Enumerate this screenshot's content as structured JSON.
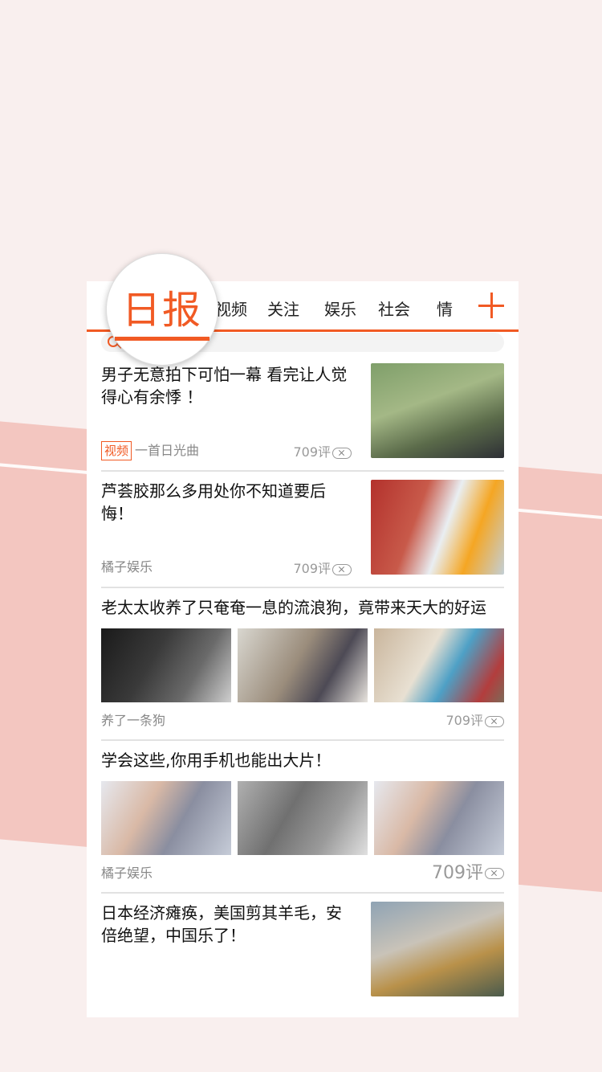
{
  "tabs": {
    "active_zoomed": "日报",
    "items": [
      "视频",
      "关注",
      "娱乐",
      "社会",
      "情"
    ]
  },
  "colors": {
    "accent": "#f15a24",
    "background": "#f9efee",
    "band": "#f3c6c0"
  },
  "icons": {
    "add": "plus-icon",
    "search": "search-icon",
    "dismiss": "close-icon"
  },
  "feed": [
    {
      "title": "男子无意拍下可怕一幕 看完让人觉得心有余悸 ！",
      "tag": "视频",
      "source": "一首日光曲",
      "comments": "709评"
    },
    {
      "title": "芦荟胶那么多用处你不知道要后悔！",
      "source": "橘子娱乐",
      "comments": "709评"
    },
    {
      "title": "老太太收养了只奄奄一息的流浪狗，竟带来天大的好运",
      "source": "养了一条狗",
      "comments": "709评"
    },
    {
      "title": "学会这些,你用手机也能出大片！",
      "source": "橘子娱乐",
      "comments": "709评"
    },
    {
      "title": "日本经济瘫痪，美国剪其羊毛，安倍绝望，中国乐了！"
    }
  ]
}
